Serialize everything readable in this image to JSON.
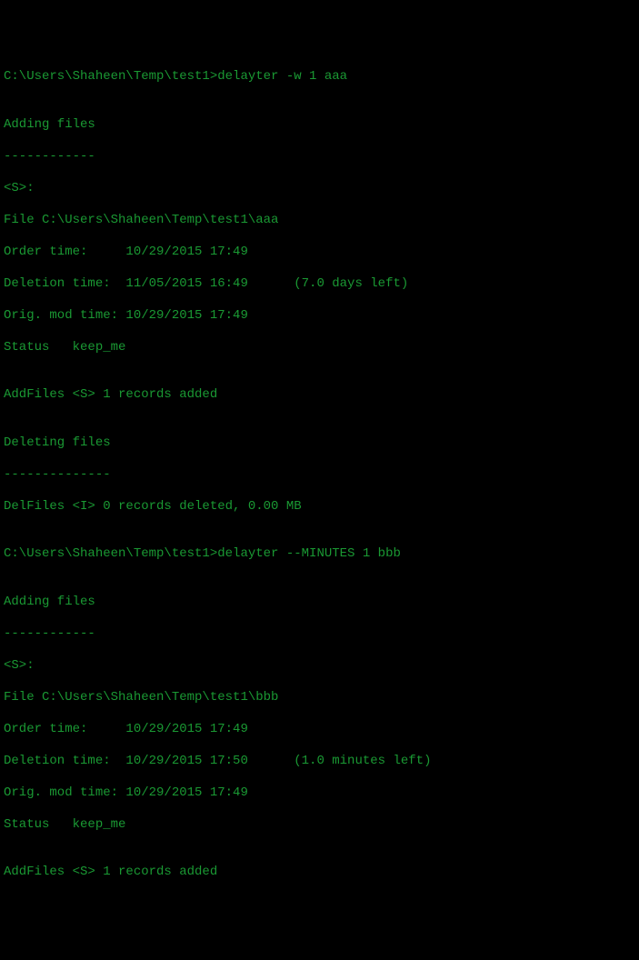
{
  "block1": {
    "prompt": "C:\\Users\\Shaheen\\Temp\\test1>delayter -w 1 aaa",
    "blank1": "",
    "adding_header": "Adding files",
    "adding_rule": "------------",
    "s_tag": "<S>:",
    "file_line": "File C:\\Users\\Shaheen\\Temp\\test1\\aaa",
    "order_time": "Order time:     10/29/2015 17:49",
    "deletion_time": "Deletion time:  11/05/2015 16:49      (7.0 days left)",
    "orig_mod": "Orig. mod time: 10/29/2015 17:49",
    "status": "Status   keep_me",
    "blank2": "",
    "add_result": "AddFiles <S> 1 records added",
    "blank3": "",
    "deleting_header": "Deleting files",
    "deleting_rule": "--------------",
    "del_result": "DelFiles <I> 0 records deleted, 0.00 MB"
  },
  "blank_mid": "",
  "block2": {
    "prompt": "C:\\Users\\Shaheen\\Temp\\test1>delayter --MINUTES 1 bbb",
    "blank1": "",
    "adding_header": "Adding files",
    "adding_rule": "------------",
    "s_tag": "<S>:",
    "file_line": "File C:\\Users\\Shaheen\\Temp\\test1\\bbb",
    "order_time": "Order time:     10/29/2015 17:49",
    "deletion_time": "Deletion time:  10/29/2015 17:50      (1.0 minutes left)",
    "orig_mod": "Orig. mod time: 10/29/2015 17:49",
    "status": "Status   keep_me",
    "blank2": "",
    "add_result": "AddFiles <S> 1 records added"
  }
}
